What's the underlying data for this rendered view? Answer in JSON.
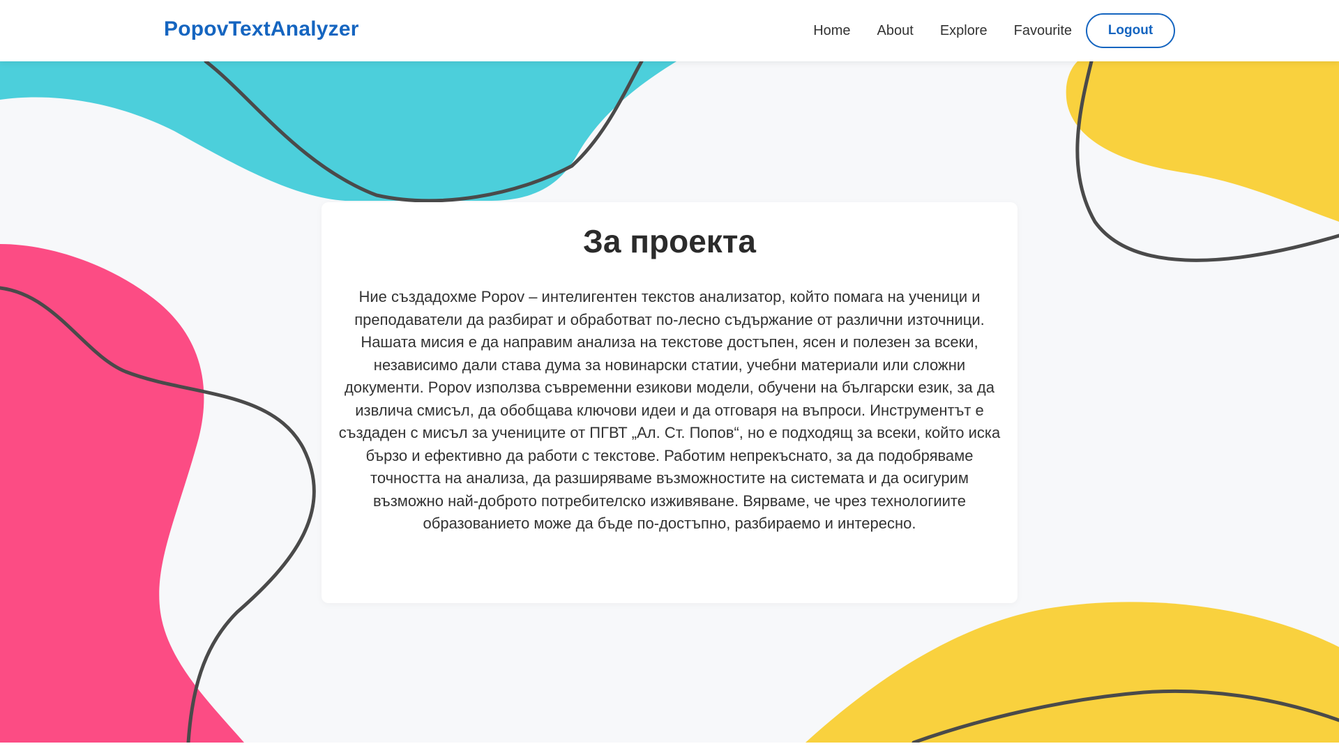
{
  "header": {
    "brand": "PopovTextAnalyzer",
    "nav": [
      {
        "label": "Home"
      },
      {
        "label": "About"
      },
      {
        "label": "Explore"
      },
      {
        "label": "Favourite"
      }
    ],
    "logout_label": "Logout"
  },
  "about": {
    "title": "За проекта",
    "text": "Ние създадохме Popov – интелигентен текстов анализатор, който помага на ученици и преподаватели да разбират и обработват по-лесно съдържание от различни източници. Нашата мисия е да направим анализа на текстове достъпен, ясен и полезен за всеки, независимо дали става дума за новинарски статии, учебни материали или сложни документи. Popov използва съвременни езикови модели, обучени на български език, за да извлича смисъл, да обобщава ключови идеи и да отговаря на въпроси. Инструментът е създаден с мисъл за учениците от ПГВТ „Ал. Ст. Попов“, но е подходящ за всеки, който иска бързо и ефективно да работи с текстове. Работим непрекъснато, за да подобряваме точността на анализа, да разширяваме възможностите на системата и да осигурим възможно най-доброто потребителско изживяване. Вярваме, че чрез технологиите образованието може да бъде по-достъпно, разбираемо и интересно."
  },
  "colors": {
    "brand": "#1565c0",
    "blob_cyan": "#4ccfdb",
    "blob_yellow": "#f9d13e",
    "blob_pink": "#fc4c84",
    "line": "#4a4a4a",
    "background": "#f7f8fa"
  }
}
